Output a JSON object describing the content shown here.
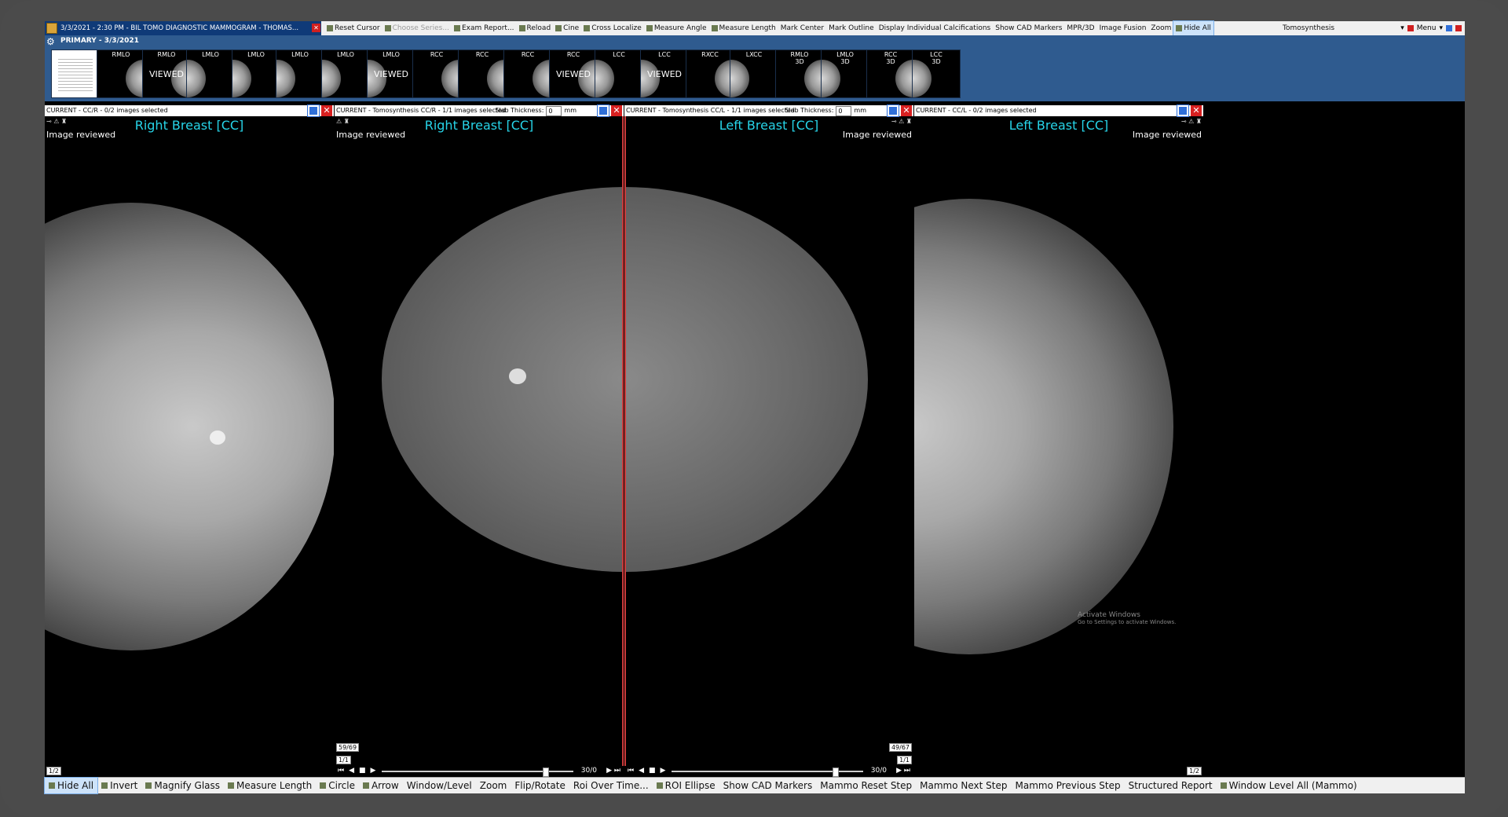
{
  "window": {
    "patient_title": "3/3/2021 - 2:30 PM - BIL TOMO DIAGNOSTIC MAMMOGRAM - THOMAS...",
    "study_label": "Tomosynthesis",
    "menu_label": "Menu"
  },
  "top_tools": [
    {
      "label": "Reset Cursor",
      "state": "normal",
      "icon": "cursor-icon"
    },
    {
      "label": "Choose Series...",
      "state": "disabled",
      "icon": "series-icon"
    },
    {
      "label": "Exam Report...",
      "state": "normal",
      "icon": "report-icon"
    },
    {
      "label": "Reload",
      "state": "normal",
      "icon": "reload-icon"
    },
    {
      "label": "Cine",
      "state": "normal",
      "icon": "cine-icon"
    },
    {
      "label": "Cross Localize",
      "state": "normal",
      "icon": "crosshair-icon"
    },
    {
      "label": "Measure Angle",
      "state": "normal",
      "icon": "angle-icon"
    },
    {
      "label": "Measure Length",
      "state": "normal",
      "icon": "ruler-icon"
    },
    {
      "label": "Mark Center",
      "state": "normal",
      "icon": ""
    },
    {
      "label": "Mark Outline",
      "state": "normal",
      "icon": ""
    },
    {
      "label": "Display Individual Calcifications",
      "state": "normal",
      "icon": ""
    },
    {
      "label": "Show CAD Markers",
      "state": "normal",
      "icon": ""
    },
    {
      "label": "MPR/3D",
      "state": "normal",
      "icon": ""
    },
    {
      "label": "Image Fusion",
      "state": "normal",
      "icon": ""
    },
    {
      "label": "Zoom",
      "state": "normal",
      "icon": ""
    },
    {
      "label": "Hide All",
      "state": "active",
      "icon": "hide-icon"
    }
  ],
  "thumbnails": {
    "group_label": "PRIMARY - 3/3/2021",
    "items": [
      {
        "label": "",
        "viewed": "",
        "kind": "doc"
      },
      {
        "label": "RMLO",
        "viewed": "",
        "kind": "r"
      },
      {
        "label": "RMLO",
        "viewed": "VIEWED",
        "kind": "r"
      },
      {
        "label": "LMLO",
        "viewed": "",
        "kind": "l"
      },
      {
        "label": "LMLO",
        "viewed": "",
        "kind": "l"
      },
      {
        "label": "LMLO",
        "viewed": "",
        "kind": "l"
      },
      {
        "label": "LMLO",
        "viewed": "",
        "kind": "l"
      },
      {
        "label": "LMLO",
        "viewed": "VIEWED",
        "kind": "l"
      },
      {
        "label": "RCC",
        "viewed": "",
        "kind": "r"
      },
      {
        "label": "RCC",
        "viewed": "",
        "kind": "r"
      },
      {
        "label": "RCC",
        "viewed": "",
        "kind": "r"
      },
      {
        "label": "RCC",
        "viewed": "VIEWED",
        "kind": "r"
      },
      {
        "label": "LCC",
        "viewed": "",
        "kind": "l"
      },
      {
        "label": "LCC",
        "viewed": "VIEWED",
        "kind": "l"
      },
      {
        "label": "RXCC",
        "viewed": "",
        "kind": "r"
      },
      {
        "label": "LXCC",
        "viewed": "",
        "kind": "l"
      },
      {
        "label": "RMLO\n3D",
        "viewed": "",
        "kind": "r"
      },
      {
        "label": "LMLO\n3D",
        "viewed": "",
        "kind": "l"
      },
      {
        "label": "RCC\n3D",
        "viewed": "",
        "kind": "r"
      },
      {
        "label": "LCC\n3D",
        "viewed": "",
        "kind": "l"
      }
    ]
  },
  "viewports": [
    {
      "header": "CURRENT - CC/R - 0/2 images selected",
      "title": "Right Breast [CC]",
      "reviewed": "Image reviewed",
      "page": "1/2",
      "slab_label": "",
      "slab_value": "",
      "slab_unit": "",
      "slice": "",
      "slice_sub": "",
      "cine_pos": ""
    },
    {
      "header": "CURRENT - Tomosynthesis CC/R - 1/1 images selected",
      "title": "Right Breast [CC]",
      "reviewed": "Image reviewed",
      "page": "",
      "slab_label": "Slab Thickness:",
      "slab_value": "0",
      "slab_unit": "mm",
      "slice": "59/69",
      "slice_sub": "1/1",
      "cine_pos": "30/0"
    },
    {
      "header": "CURRENT - Tomosynthesis CC/L - 1/1 images selected",
      "title": "Left Breast [CC]",
      "reviewed": "Image reviewed",
      "page": "",
      "slab_label": "Slab Thickness:",
      "slab_value": "0",
      "slab_unit": "mm",
      "slice": "49/67",
      "slice_sub": "1/1",
      "cine_pos": "30/0"
    },
    {
      "header": "CURRENT - CC/L - 0/2 images selected",
      "title": "Left Breast [CC]",
      "reviewed": "Image reviewed",
      "page": "1/2",
      "slab_label": "",
      "slab_value": "",
      "slab_unit": "",
      "slice": "",
      "slice_sub": "",
      "cine_pos": ""
    }
  ],
  "watermark": {
    "line1": "Activate Windows",
    "line2": "Go to Settings to activate Windows."
  },
  "bottom_tools": [
    {
      "label": "Hide All",
      "state": "active",
      "icon": "hide-icon"
    },
    {
      "label": "Invert",
      "state": "normal",
      "icon": "invert-icon"
    },
    {
      "label": "Magnify Glass",
      "state": "normal",
      "icon": "magnify-icon"
    },
    {
      "label": "Measure Length",
      "state": "normal",
      "icon": "ruler-icon"
    },
    {
      "label": "Circle",
      "state": "normal",
      "icon": "circle-icon"
    },
    {
      "label": "Arrow",
      "state": "normal",
      "icon": "arrow-icon"
    },
    {
      "label": "Window/Level",
      "state": "normal",
      "icon": ""
    },
    {
      "label": "Zoom",
      "state": "normal",
      "icon": ""
    },
    {
      "label": "Flip/Rotate",
      "state": "normal",
      "icon": ""
    },
    {
      "label": "Roi Over Time...",
      "state": "normal",
      "icon": ""
    },
    {
      "label": "ROI Ellipse",
      "state": "normal",
      "icon": "ellipse-icon"
    },
    {
      "label": "Show CAD Markers",
      "state": "normal",
      "icon": ""
    },
    {
      "label": "Mammo Reset Step",
      "state": "normal",
      "icon": ""
    },
    {
      "label": "Mammo Next Step",
      "state": "normal",
      "icon": ""
    },
    {
      "label": "Mammo Previous Step",
      "state": "normal",
      "icon": ""
    },
    {
      "label": "Structured Report",
      "state": "normal",
      "icon": ""
    },
    {
      "label": "Window Level All (Mammo)",
      "state": "normal",
      "icon": "window-level-icon"
    }
  ]
}
